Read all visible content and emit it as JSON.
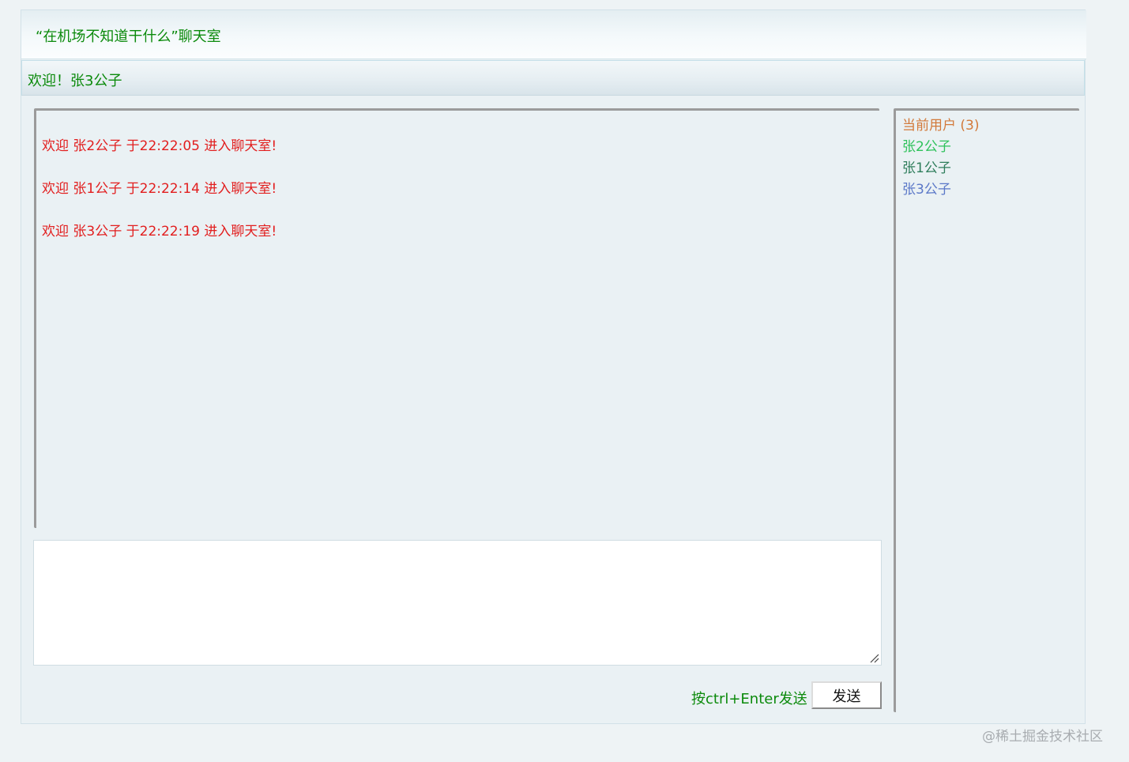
{
  "header": {
    "title": "“在机场不知道干什么”聊天室"
  },
  "welcome": {
    "text": "欢迎！张3公子"
  },
  "messages": [
    {
      "text": "欢迎 张2公子 于22:22:05 进入聊天室!"
    },
    {
      "text": "欢迎 张1公子 于22:22:14 进入聊天室!"
    },
    {
      "text": "欢迎 张3公子 于22:22:19 进入聊天室!"
    }
  ],
  "composer": {
    "value": "",
    "hint": "按ctrl+Enter发送",
    "send_label": "发送"
  },
  "users": {
    "header": "当前用户 (3)",
    "list": [
      {
        "name": "张2公子",
        "color": "#2fc25b"
      },
      {
        "name": "张1公子",
        "color": "#2e7d5b"
      },
      {
        "name": "张3公子",
        "color": "#5b78c8"
      }
    ]
  },
  "watermark": "@稀土掘金技术社区",
  "colors": {
    "title_green": "#0b8a0b",
    "message_red": "#e21e1e",
    "users_header_orange": "#d2793a"
  },
  "icons": {
    "resize_grip": "resize-grip-icon"
  }
}
